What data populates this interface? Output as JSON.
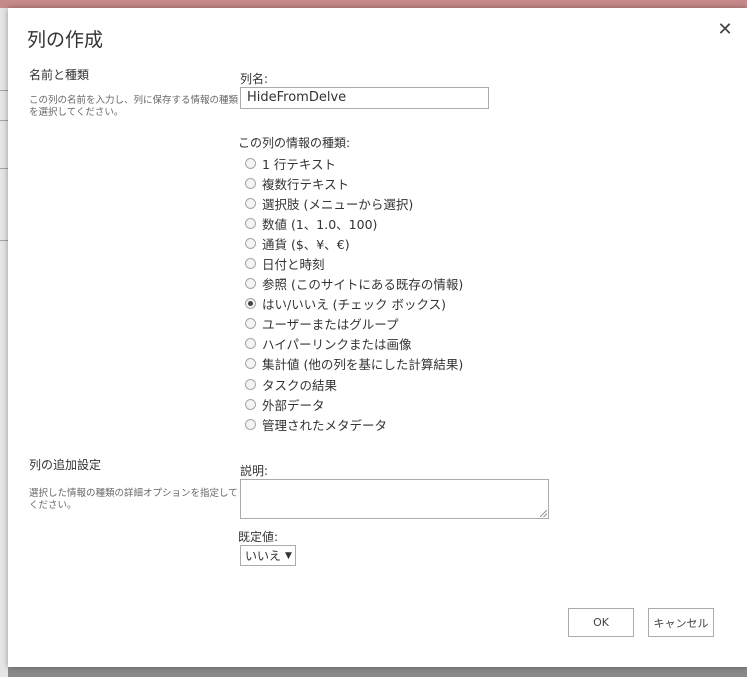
{
  "dialog": {
    "title": "列の作成",
    "close_glyph": "✕"
  },
  "name_section": {
    "title": "名前と種類",
    "description": "この列の名前を入力し、列に保存する情報の種類を選択してください。"
  },
  "column_name": {
    "label": "列名:",
    "value": "HideFromDelve"
  },
  "column_type": {
    "label": "この列の情報の種類:",
    "options": [
      {
        "label": "1 行テキスト",
        "checked": false
      },
      {
        "label": "複数行テキスト",
        "checked": false
      },
      {
        "label": "選択肢 (メニューから選択)",
        "checked": false
      },
      {
        "label": "数値 (1、1.0、100)",
        "checked": false
      },
      {
        "label": "通貨 ($、¥、€)",
        "checked": false
      },
      {
        "label": "日付と時刻",
        "checked": false
      },
      {
        "label": "参照 (このサイトにある既存の情報)",
        "checked": false
      },
      {
        "label": "はい/いいえ (チェック ボックス)",
        "checked": true
      },
      {
        "label": "ユーザーまたはグループ",
        "checked": false
      },
      {
        "label": "ハイパーリンクまたは画像",
        "checked": false
      },
      {
        "label": "集計値 (他の列を基にした計算結果)",
        "checked": false
      },
      {
        "label": "タスクの結果",
        "checked": false
      },
      {
        "label": "外部データ",
        "checked": false
      },
      {
        "label": "管理されたメタデータ",
        "checked": false
      }
    ]
  },
  "additional_section": {
    "title": "列の追加設定",
    "description": "選択した情報の種類の詳細オプションを指定してください。"
  },
  "description_field": {
    "label": "説明:",
    "value": ""
  },
  "default_value": {
    "label": "既定値:",
    "selected": "いいえ",
    "arrow": "▼"
  },
  "buttons": {
    "ok": "OK",
    "cancel": "キャンセル"
  }
}
